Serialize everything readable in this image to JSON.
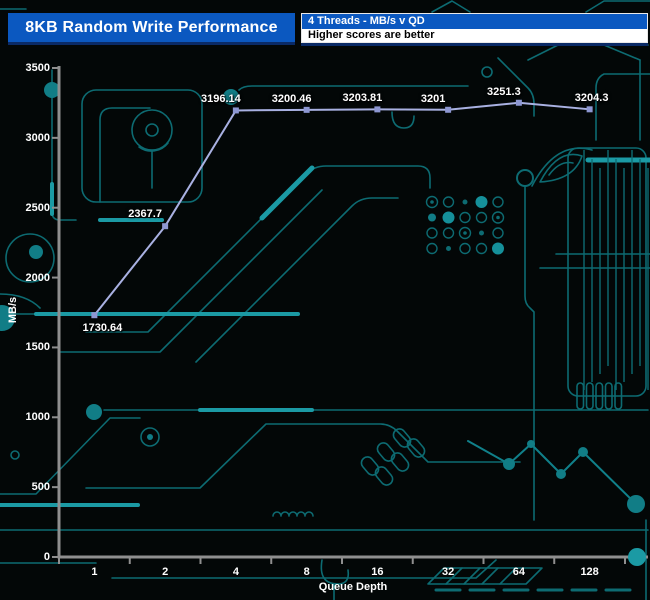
{
  "header": {
    "title": "8KB Random Write Performance",
    "subtitle_line1": "4 Threads - MB/s v QD",
    "subtitle_line2": "Higher scores are better",
    "title_bg": "#0b58c0",
    "subtitle_bg": "#ffffff"
  },
  "chart_data": {
    "type": "line",
    "title": "8KB Random Write Performance",
    "subtitle": "4 Threads - MB/s v QD",
    "note": "Higher scores are better",
    "categories": [
      "1",
      "2",
      "4",
      "8",
      "16",
      "32",
      "64",
      "128"
    ],
    "series": [
      {
        "name": "4 Threads - MB/s v QD",
        "values": [
          1730.64,
          2367.7,
          3196.14,
          3200.46,
          3203.81,
          3201,
          3251.3,
          3204.3
        ]
      }
    ],
    "data_labels": [
      "1730.64",
      "2367.7",
      "3196.14",
      "3200.46",
      "3203.81",
      "3201",
      "3251.3",
      "3204.3"
    ],
    "xlabel": "Queue Depth",
    "ylabel": "MB/s",
    "ylim": [
      0,
      3500
    ],
    "yticks": [
      0,
      500,
      1000,
      1500,
      2000,
      2500,
      3000,
      3500
    ],
    "grid": false,
    "legend_position": "none",
    "line_color": "#a9b1e2",
    "marker_color": "#8d97d2",
    "axis_color": "#8f8f8f",
    "label_color": "#ffffff",
    "background_color": "#030707",
    "circuit_trace_color": "#0d6b72",
    "circuit_bright_color": "#1b9aa4"
  }
}
